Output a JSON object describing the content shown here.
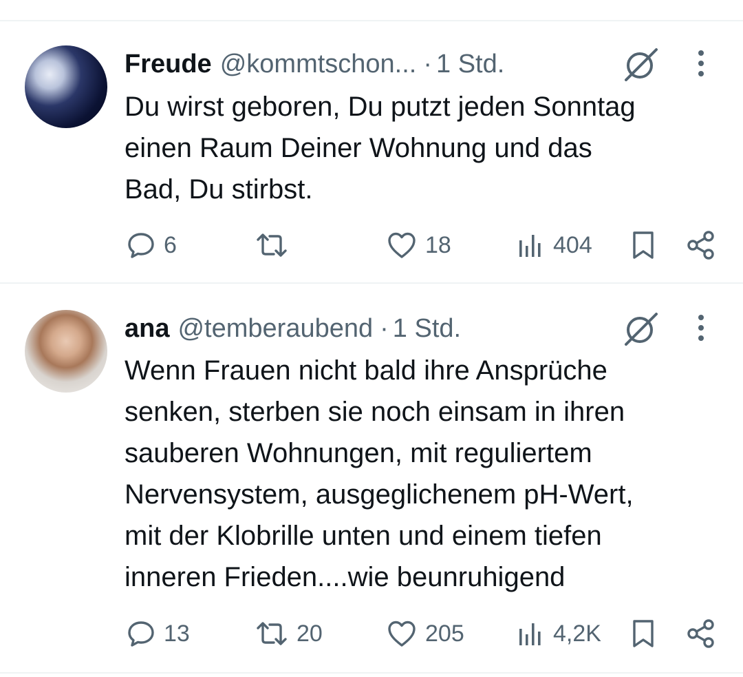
{
  "tweets": [
    {
      "name": "Freude",
      "handle": "@kommtschon...",
      "dot": "·",
      "time": "1 Std.",
      "lines": [
        "Du wirst geboren, Du putzt jeden Sonntag",
        "einen Raum Deiner Wohnung und das",
        "Bad, Du stirbst."
      ],
      "replies": "6",
      "retweets": "",
      "likes": "18",
      "views": "404"
    },
    {
      "name": "ana",
      "handle": "@temberaubend",
      "dot": "·",
      "time": "1 Std.",
      "lines": [
        "Wenn Frauen nicht bald ihre Ansprüche",
        "senken, sterben sie noch einsam in ihren",
        "sauberen Wohnungen, mit reguliertem",
        "Nervensystem, ausgeglichenem pH-Wert,",
        "mit der Klobrille unten und einem tiefen",
        "inneren Frieden....wie beunruhigend"
      ],
      "replies": "13",
      "retweets": "20",
      "likes": "205",
      "views": "4,2K"
    }
  ],
  "colors": {
    "text": "#0f1419",
    "muted": "#536471",
    "divider": "#eff3f4"
  },
  "icons": [
    "reply-icon",
    "retweet-icon",
    "like-icon",
    "views-icon",
    "bookmark-icon",
    "share-icon",
    "grok-icon",
    "more-icon"
  ]
}
